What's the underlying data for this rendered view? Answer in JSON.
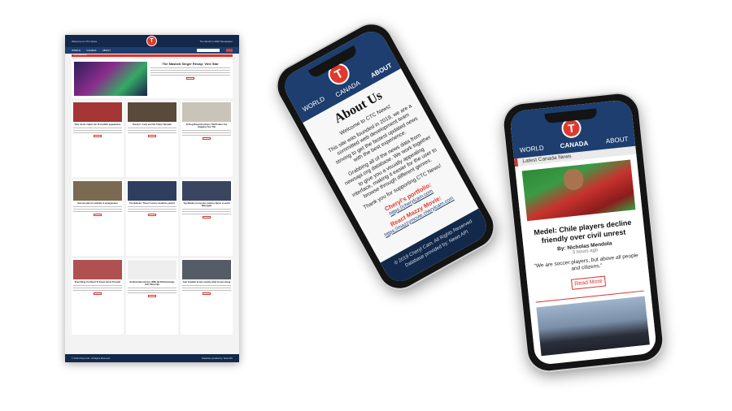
{
  "desktop": {
    "top_left": "Welcome to CTC News",
    "top_right": "The World in 2020 Newspaper",
    "logo": "T",
    "nav": [
      "WORLD",
      "CANADA",
      "ABOUT"
    ],
    "red_bar": "Latest World News",
    "feature_title": "The Masked Singer Recap: Vine Star",
    "cards": [
      "Katy Jones makes her first public appearance",
      "Disney's 'Lady and the Tramp' Remake",
      "22 Dog Breed Groomers That'll Have You Hugging Your Tail",
      "How we plan for animals in emergencies",
      "The Batman: These 5 actors would be perfect",
      "Top Mueller prosecutor advises Dems to avoid Watergate",
      "Everything You Need To Know About Triumph",
      "Kindred Biosciences (KIN) Q3 2019 Earnings Call Transcript",
      "Ivan Grealish knows exactly what he was doing"
    ],
    "footer_left": "© 2019 Cheryl Cam. All Rights Reserved.",
    "footer_right": "Database provided by: News API"
  },
  "about_phone": {
    "tabs": {
      "world": "WORLD",
      "canada": "CANADA",
      "about": "ABOUT"
    },
    "logo": "T",
    "title": "About Us",
    "p1": "Welcome to CTC News!",
    "p2": "This site was founded in 2019, we are a committed web development team striving to get the fastest updated news with the best experience.",
    "p3": "Grabbing all of the news data from newsapi.org database. We work together to give you a visually appealing interface, making it easier for the user to browse through different genres.",
    "p4": "Thank you for supporting CTC News!",
    "portfolio_label": "Cheryl's portfolio:",
    "portfolio_url": "https://cherylcam.com",
    "movie_label": "React Mazzy Movie:",
    "movie_url": "https://mazzymovie.cherylcam.com",
    "footer1": "© 2019 Cheryl Cam. All Rights Reserved",
    "footer2": "Database provided by: News API"
  },
  "canada_phone": {
    "tabs": {
      "world": "WORLD",
      "canada": "CANADA",
      "about": "ABOUT"
    },
    "logo": "T",
    "bar": "Latest Canada News",
    "title": "Medel: Chile players decline friendly over civil unrest",
    "byline": "By: Nicholas Mendola",
    "time": "3 hours ago",
    "quote": "\"We are soccer players, but above all people and citizens.\"",
    "read_more": "Read More"
  }
}
